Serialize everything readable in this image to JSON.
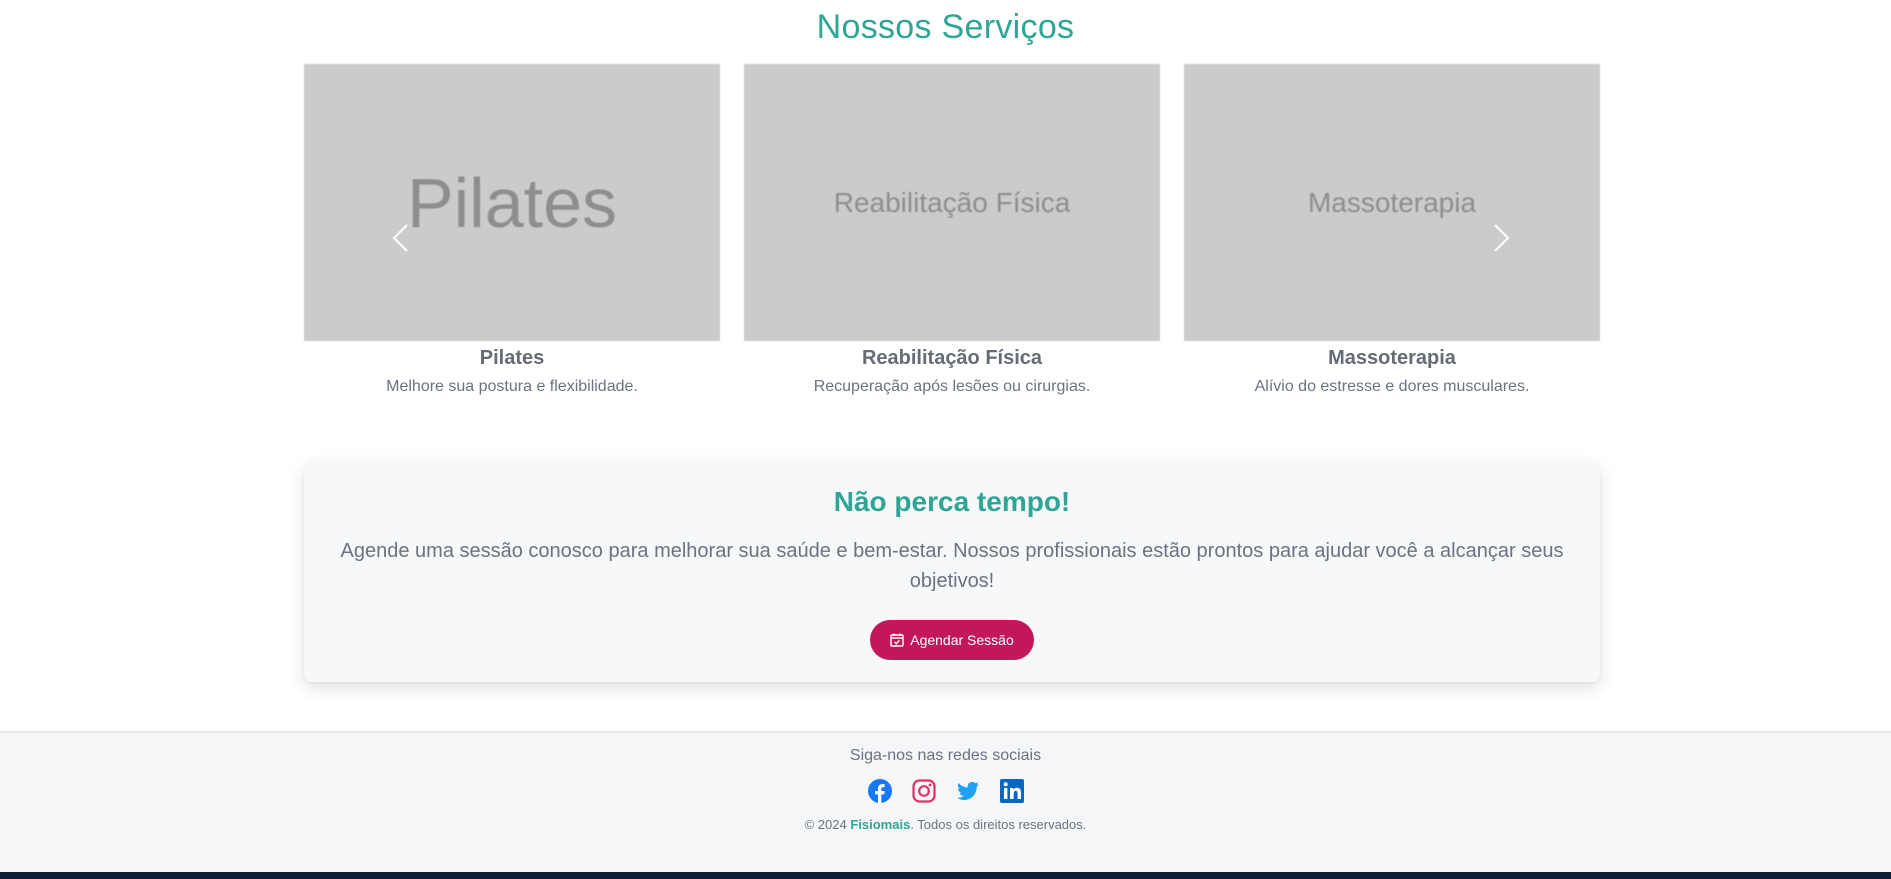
{
  "services": {
    "title": "Nossos Serviços",
    "cards": [
      {
        "image_text": "Pilates",
        "title": "Pilates",
        "description": "Melhore sua postura e flexibilidade."
      },
      {
        "image_text": "Reabilitação Física",
        "title": "Reabilitação Física",
        "description": "Recuperação após lesões ou cirurgias."
      },
      {
        "image_text": "Massoterapia",
        "title": "Massoterapia",
        "description": "Alívio do estresse e dores musculares."
      }
    ],
    "prev_icon": "chevron-left-icon",
    "next_icon": "chevron-right-icon"
  },
  "cta": {
    "title": "Não perca tempo!",
    "text": "Agende uma sessão conosco para melhorar sua saúde e bem-estar. Nossos profissionais estão prontos para ajudar você a alcançar seus objetivos!",
    "button_label": "Agendar Sessão",
    "button_icon": "calendar-check-icon"
  },
  "footer": {
    "heading": "Siga-nos nas redes sociais",
    "social": [
      {
        "name": "facebook-icon",
        "color": "#1877f2"
      },
      {
        "name": "instagram-icon",
        "color": "#e1306c"
      },
      {
        "name": "twitter-icon",
        "color": "#1da1f2"
      },
      {
        "name": "linkedin-icon",
        "color": "#0a66c2"
      }
    ],
    "copyright_prefix": "© 2024 ",
    "brand": "Fisiomais",
    "copyright_suffix": ". Todos os direitos reservados."
  },
  "colors": {
    "accent": "#2fa596",
    "button": "#c2185b",
    "placeholder": "#cbcbcb",
    "bottom_bar": "#0f1f33"
  }
}
